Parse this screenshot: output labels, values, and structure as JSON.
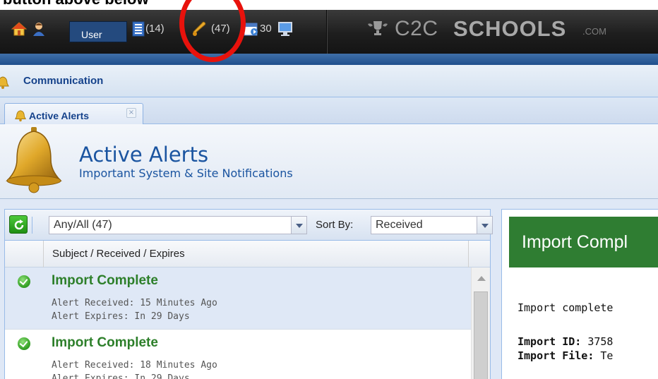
{
  "header": {
    "cutoff_text": "button above below",
    "user_label": "User",
    "list_count": "(14)",
    "alerts_count": "(47)",
    "events_count": "30",
    "brand_light": "C2C",
    "brand_bold": "SCHOOLS",
    "brand_suffix": ".COM",
    "icons": [
      "home-icon",
      "user-icon",
      "list-icon",
      "bell-icon",
      "calendar-icon",
      "monitor-icon"
    ],
    "highlight_color": "#e8120c"
  },
  "panel": {
    "title": "Communication"
  },
  "tabs": [
    {
      "label": "Active Alerts",
      "close": "×"
    }
  ],
  "hero": {
    "title": "Active Alerts",
    "subtitle": "Important System & Site Notifications"
  },
  "toolbar": {
    "filter_value": "Any/All (47)",
    "sort_label": "Sort By:",
    "sort_value": "Received"
  },
  "list": {
    "column_header": "Subject / Received / Expires",
    "rows": [
      {
        "subject": "Import Complete",
        "received": "Alert Received: 15 Minutes Ago",
        "expires": "Alert Expires: In 29 Days",
        "selected": true
      },
      {
        "subject": "Import Complete",
        "received": "Alert Received: 18 Minutes Ago",
        "expires": "Alert Expires: In 29 Days",
        "selected": false
      }
    ]
  },
  "detail": {
    "title": "Import Compl",
    "line1": "Import complete",
    "id_label": "Import ID:",
    "id_value": "3758",
    "file_label": "Import File:",
    "file_value": "Te",
    "banner_color": "#2f7d32"
  }
}
